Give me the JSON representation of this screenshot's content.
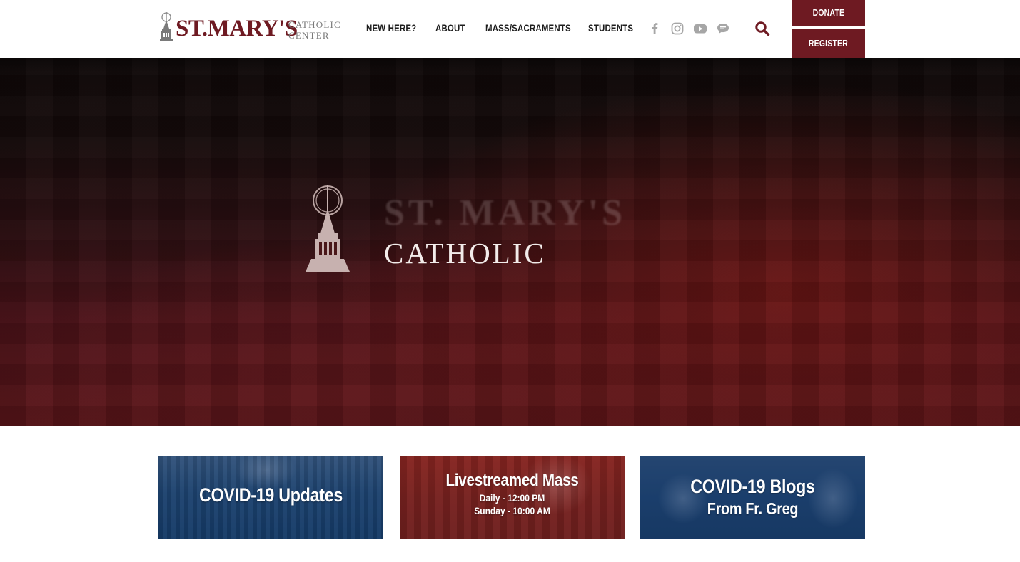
{
  "brand": {
    "name": "ST.MARY'S",
    "sub_line1": "CATHOLIC",
    "sub_line2": "CENTER",
    "primary_color": "#6e1a22"
  },
  "nav": {
    "items": [
      {
        "label": "NEW HERE?"
      },
      {
        "label": "ABOUT"
      },
      {
        "label": "MASS/SACRAMENTS"
      },
      {
        "label": "STUDENTS"
      }
    ]
  },
  "social": {
    "icons": [
      "facebook-icon",
      "instagram-icon",
      "youtube-icon",
      "chat-bubble-icon"
    ],
    "color": "#a6a6a6"
  },
  "search": {
    "icon": "search-icon",
    "color": "#6e1a22"
  },
  "actions": {
    "donate_label": "DONATE",
    "register_label": "REGISTER"
  },
  "hero": {
    "title": "ST. MARY'S",
    "subtitle": "CATHOLIC"
  },
  "tiles": [
    {
      "title": "COVID-19 Updates"
    },
    {
      "title": "Livestreamed Mass",
      "line1": "Daily - 12:00 PM",
      "line2": "Sunday - 10:00 AM"
    },
    {
      "title": "COVID-19 Blogs",
      "line1": "From Fr. Greg"
    }
  ]
}
